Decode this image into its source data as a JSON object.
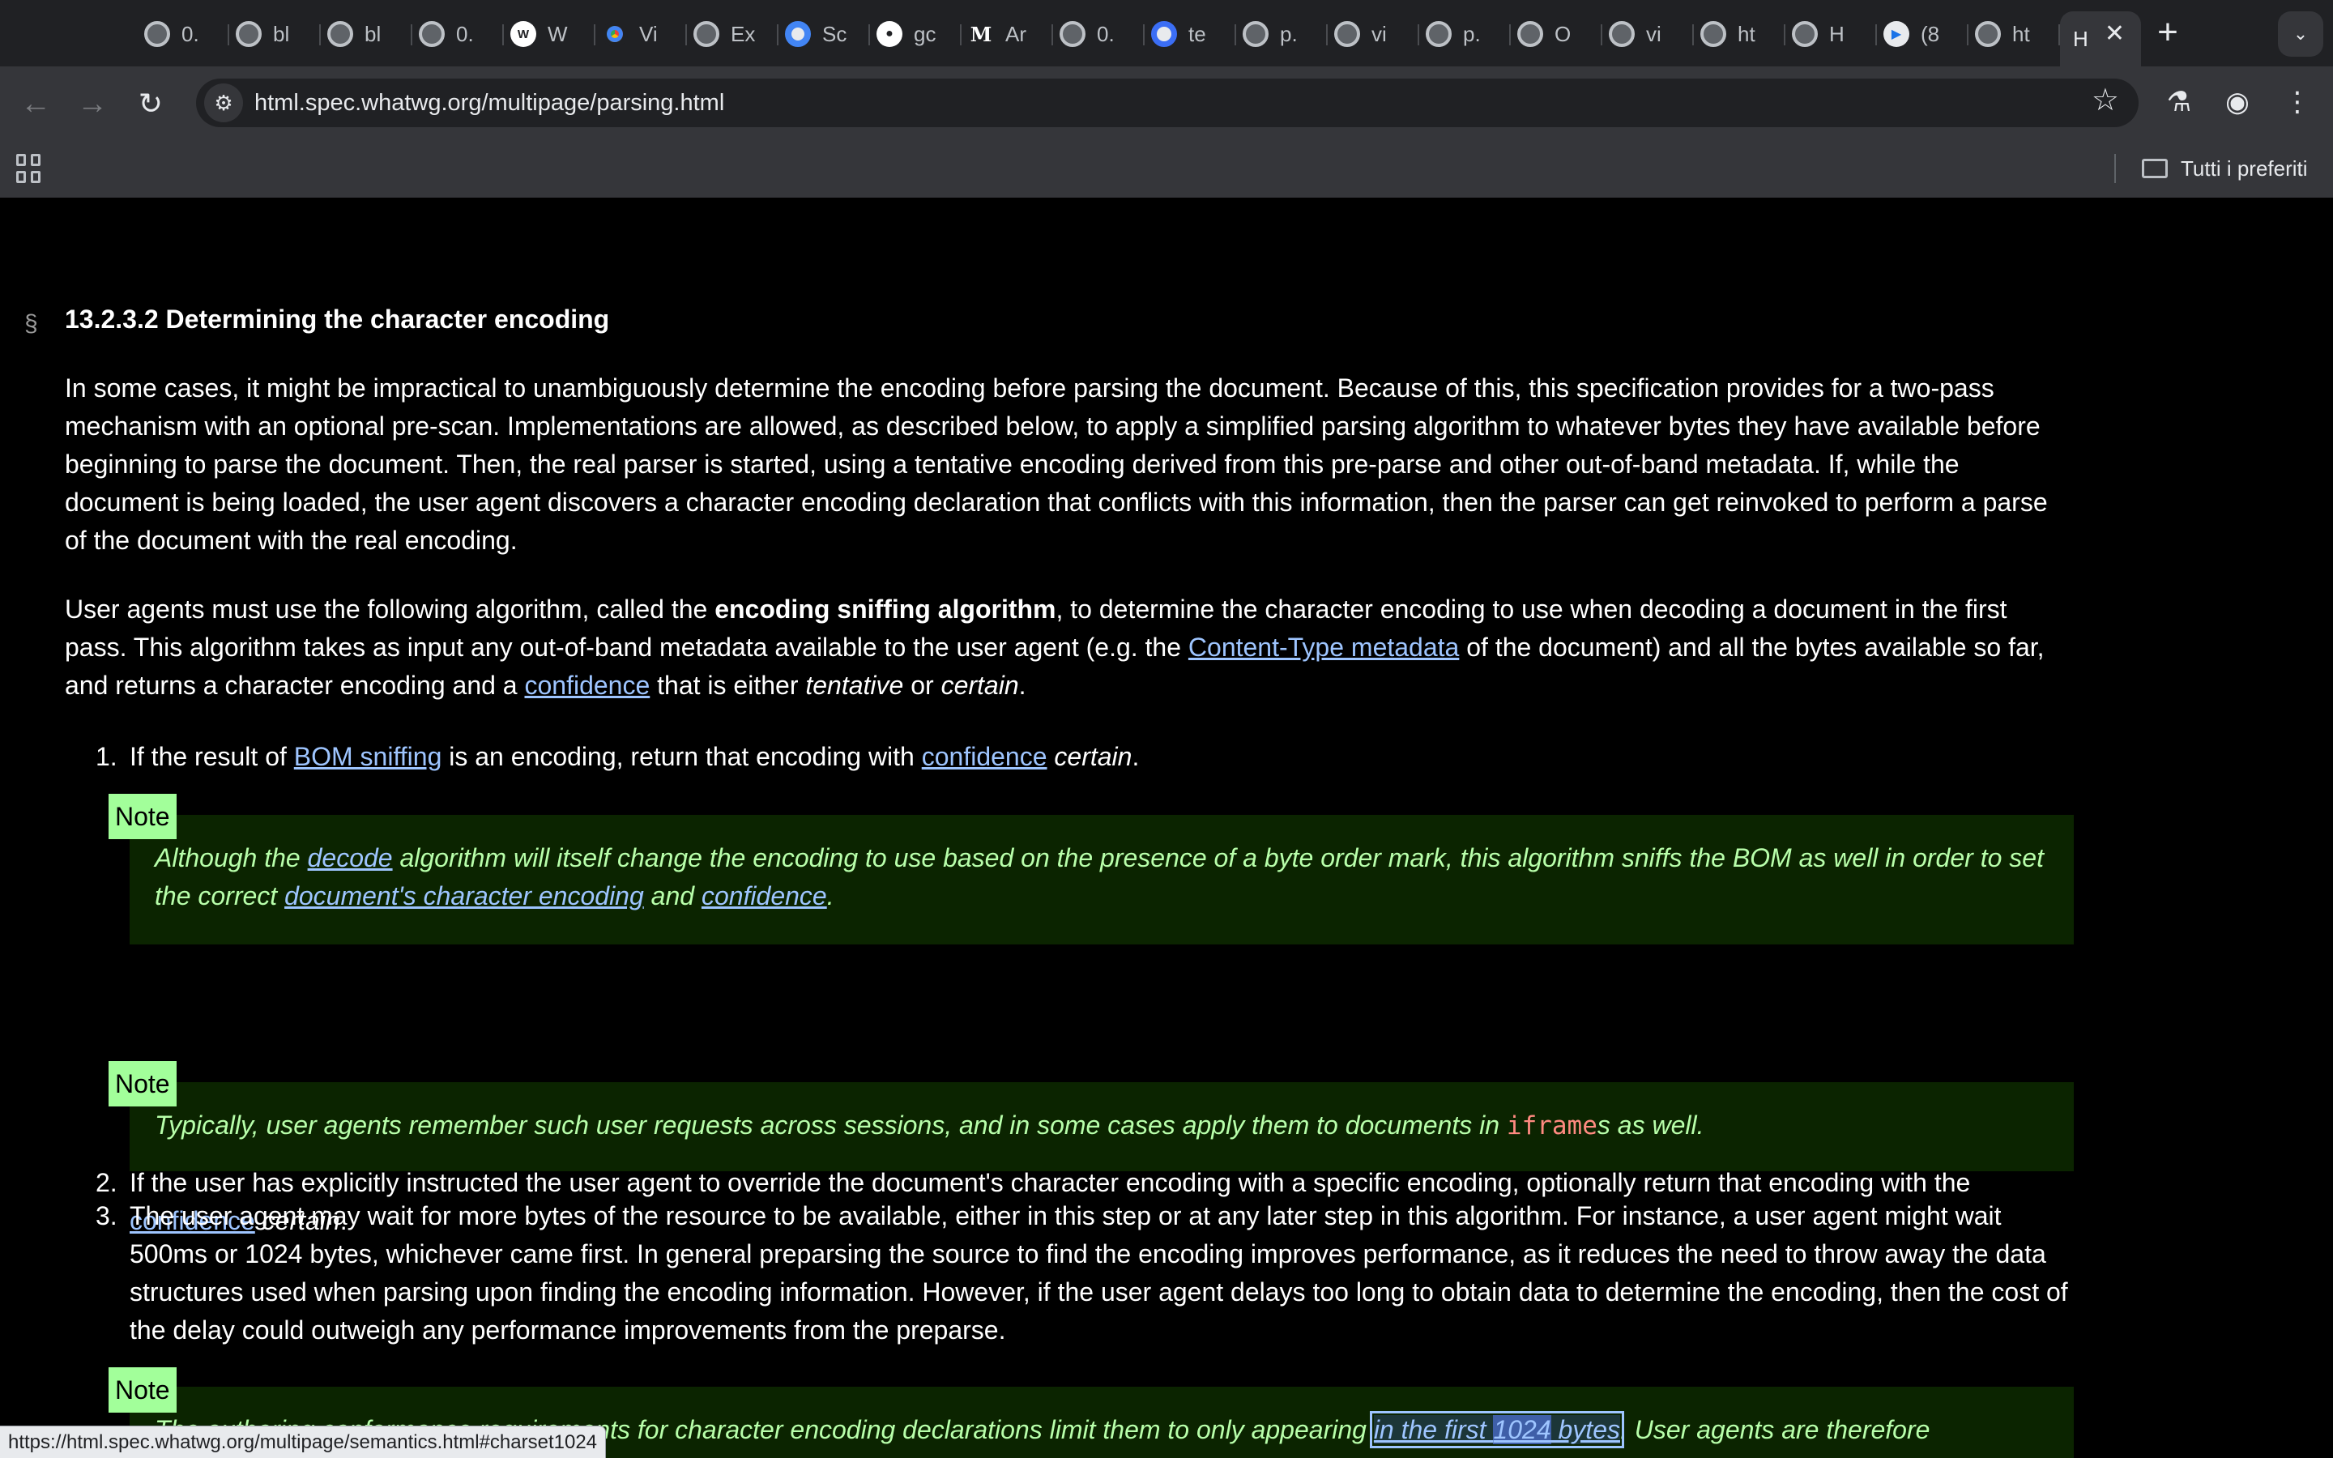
{
  "browser": {
    "tabs": [
      {
        "title": "0.",
        "icon": "globe-icon"
      },
      {
        "title": "bl",
        "icon": "globe-icon"
      },
      {
        "title": "bl",
        "icon": "globe-icon"
      },
      {
        "title": "0.",
        "icon": "globe-icon"
      },
      {
        "title": "W",
        "icon": "we-icon"
      },
      {
        "title": "Vi",
        "icon": "chrome-icon"
      },
      {
        "title": "Ex",
        "icon": "globe-icon"
      },
      {
        "title": "Sc",
        "icon": "google-icon"
      },
      {
        "title": "gc",
        "icon": "github-icon"
      },
      {
        "title": "Ar",
        "icon": "medium-icon"
      },
      {
        "title": "0.",
        "icon": "globe-icon"
      },
      {
        "title": "te",
        "icon": "gemini-icon"
      },
      {
        "title": "p.",
        "icon": "globe-icon"
      },
      {
        "title": "vi",
        "icon": "globe-icon"
      },
      {
        "title": "p.",
        "icon": "globe-icon"
      },
      {
        "title": "O",
        "icon": "globe-icon"
      },
      {
        "title": "vi",
        "icon": "globe-icon"
      },
      {
        "title": "ht",
        "icon": "globe-icon"
      },
      {
        "title": "H",
        "icon": "globe-icon"
      },
      {
        "title": "(8",
        "icon": "play-icon"
      },
      {
        "title": "ht",
        "icon": "globe-icon"
      }
    ],
    "active_tab": {
      "title": "H",
      "close": "✕"
    },
    "new_tab": "+",
    "tab_search": "⌄",
    "url": "html.spec.whatwg.org/multipage/parsing.html",
    "bookmarks": {
      "all_bookmarks": "Tutti i preferiti"
    },
    "status_url": "https://html.spec.whatwg.org/multipage/semantics.html#charset1024"
  },
  "doc": {
    "section_symbol": "§",
    "heading": "13.2.3.2 Determining the character encoding",
    "para1": "In some cases, it might be impractical to unambiguously determine the encoding before parsing the document. Because of this, this specification provides for a two-pass mechanism with an optional pre-scan. Implementations are allowed, as described below, to apply a simplified parsing algorithm to whatever bytes they have available before beginning to parse the document. Then, the real parser is started, using a tentative encoding derived from this pre-parse and other out-of-band metadata. If, while the document is being loaded, the user agent discovers a character encoding declaration that conflicts with this information, then the parser can get reinvoked to perform a parse of the document with the real encoding.",
    "para2": {
      "t1": "User agents must use the following algorithm, called the ",
      "bold": "encoding sniffing algorithm",
      "t2": ", to determine the character encoding to use when decoding a document in the first pass. This algorithm takes as input any out-of-band metadata available to the user agent (e.g. the ",
      "link1": "Content-Type metadata",
      "t3": " of the document) and all the bytes available so far, and returns a character encoding and a ",
      "link2": "confidence",
      "t4": " that is either ",
      "em1": "tentative",
      "t5": " or ",
      "em2": "certain",
      "t6": "."
    },
    "item1": {
      "num": "1.",
      "t1": "If the result of ",
      "link1": "BOM sniffing",
      "t2": " is an encoding, return that encoding with ",
      "link2": "confidence",
      "t3": " ",
      "em": "certain",
      "t4": "."
    },
    "note_label": "Note",
    "note1": {
      "t1": "Although the ",
      "link1": "decode",
      "t2": " algorithm will itself change the encoding to use based on the presence of a byte order mark, this algorithm sniffs the BOM as well in order to set the correct ",
      "link2": "document's character encoding",
      "t3": " and ",
      "link3": "confidence",
      "t4": "."
    },
    "item2": {
      "num": "2.",
      "t1": "If the user has explicitly instructed the user agent to override the document's character encoding with a specific encoding, optionally return that encoding with the ",
      "link1": "confidence",
      "t2": " ",
      "em": "certain",
      "t3": "."
    },
    "note2": {
      "t1": "Typically, user agents remember such user requests across sessions, and in some cases apply them to documents in ",
      "code": "iframe",
      "t2": "s as well."
    },
    "item3": {
      "num": "3.",
      "text": "The user agent may wait for more bytes of the resource to be available, either in this step or at any later step in this algorithm. For instance, a user agent might wait 500ms or 1024 bytes, whichever came first. In general preparsing the source to find the encoding improves performance, as it reduces the need to throw away the data structures used when parsing upon finding the encoding information. However, if the user agent delays too long to obtain data to determine the encoding, then the cost of the delay could outweigh any performance improvements from the preparse."
    },
    "note3": {
      "t1": "The authoring conformance requirements for character encoding declarations limit them to only appearing ",
      "link_a": "in the first ",
      "link_b": "1024",
      "link_c": " bytes",
      "t2": ". User agents are therefore"
    }
  }
}
